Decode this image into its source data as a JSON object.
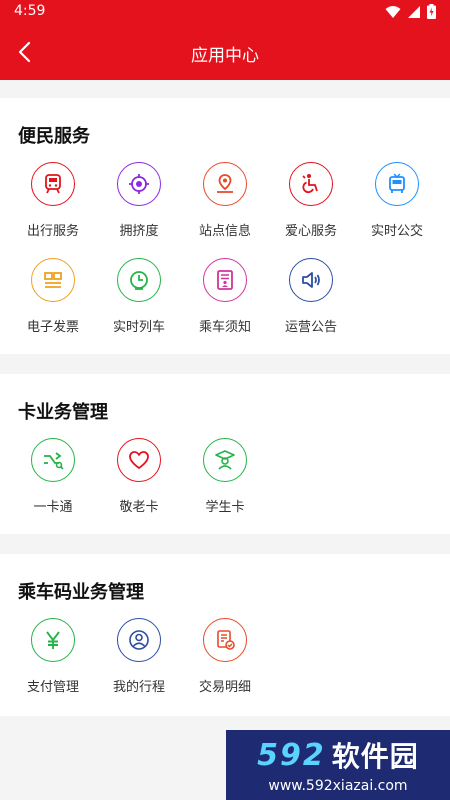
{
  "status_bar": {
    "time": "4:59"
  },
  "header": {
    "title": "应用中心"
  },
  "sections": [
    {
      "title": "便民服务",
      "items": [
        {
          "label": "出行服务",
          "icon": "train-icon",
          "color": "#e4121d"
        },
        {
          "label": "拥挤度",
          "icon": "target-icon",
          "color": "#8a2be2"
        },
        {
          "label": "站点信息",
          "icon": "map-pin-icon",
          "color": "#e84b2a"
        },
        {
          "label": "爱心服务",
          "icon": "wheelchair-icon",
          "color": "#e4121d"
        },
        {
          "label": "实时公交",
          "icon": "bus-icon",
          "color": "#1e90ff"
        },
        {
          "label": "电子发票",
          "icon": "invoice-icon",
          "color": "#f0a020"
        },
        {
          "label": "实时列车",
          "icon": "clock-icon",
          "color": "#26b34a"
        },
        {
          "label": "乘车须知",
          "icon": "notice-icon",
          "color": "#d2349b"
        },
        {
          "label": "运营公告",
          "icon": "speaker-icon",
          "color": "#2d4fa0"
        }
      ]
    },
    {
      "title": "卡业务管理",
      "items": [
        {
          "label": "一卡通",
          "icon": "card-transfer-icon",
          "color": "#26b34a"
        },
        {
          "label": "敬老卡",
          "icon": "heart-icon",
          "color": "#e4121d"
        },
        {
          "label": "学生卡",
          "icon": "student-icon",
          "color": "#26b34a"
        }
      ]
    },
    {
      "title": "乘车码业务管理",
      "items": [
        {
          "label": "支付管理",
          "icon": "yen-icon",
          "color": "#26b34a"
        },
        {
          "label": "我的行程",
          "icon": "person-icon",
          "color": "#2d4fa0"
        },
        {
          "label": "交易明细",
          "icon": "document-check-icon",
          "color": "#e84b2a"
        }
      ]
    }
  ],
  "watermark": {
    "logo_text": "592",
    "brand_text": "软件园",
    "url": "www.592xiazai.com"
  }
}
